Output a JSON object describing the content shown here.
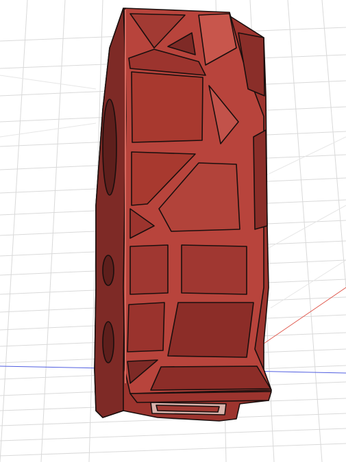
{
  "viewport": {
    "background": "#ffffff",
    "grid_color": "#d9d9d9",
    "grid_color_minor": "#ececec",
    "axis_x_color": "#e05a4f",
    "axis_y_color": "#4f5de0"
  },
  "model": {
    "body_color": "#b8443c",
    "dark_color": "#7e2a26",
    "panel_color": "#a23a33",
    "highlight_color": "#d2665c",
    "outline_color": "#1a0f0e"
  }
}
